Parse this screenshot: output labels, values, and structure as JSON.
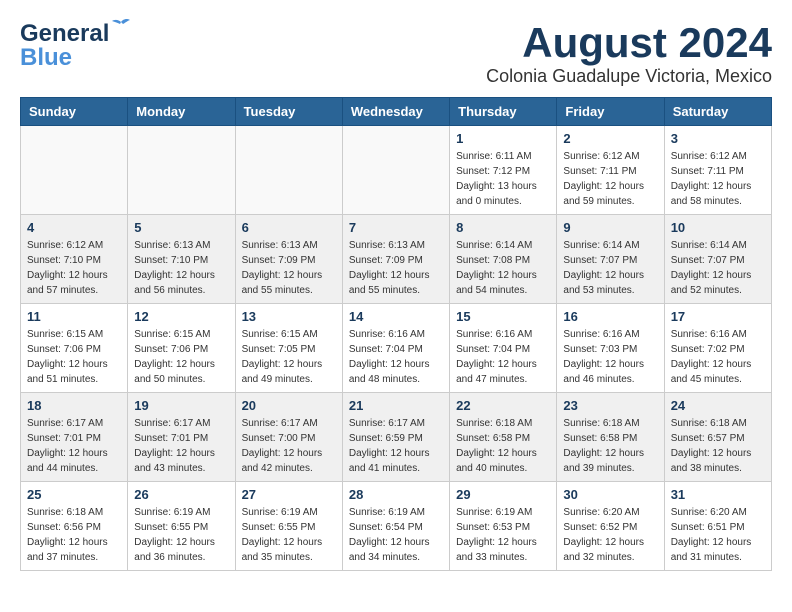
{
  "header": {
    "logo_line1": "General",
    "logo_line2": "Blue",
    "main_title": "August 2024",
    "subtitle": "Colonia Guadalupe Victoria, Mexico"
  },
  "days_of_week": [
    "Sunday",
    "Monday",
    "Tuesday",
    "Wednesday",
    "Thursday",
    "Friday",
    "Saturday"
  ],
  "weeks": [
    [
      {
        "day": "",
        "info": ""
      },
      {
        "day": "",
        "info": ""
      },
      {
        "day": "",
        "info": ""
      },
      {
        "day": "",
        "info": ""
      },
      {
        "day": "1",
        "info": "Sunrise: 6:11 AM\nSunset: 7:12 PM\nDaylight: 13 hours\nand 0 minutes."
      },
      {
        "day": "2",
        "info": "Sunrise: 6:12 AM\nSunset: 7:11 PM\nDaylight: 12 hours\nand 59 minutes."
      },
      {
        "day": "3",
        "info": "Sunrise: 6:12 AM\nSunset: 7:11 PM\nDaylight: 12 hours\nand 58 minutes."
      }
    ],
    [
      {
        "day": "4",
        "info": "Sunrise: 6:12 AM\nSunset: 7:10 PM\nDaylight: 12 hours\nand 57 minutes."
      },
      {
        "day": "5",
        "info": "Sunrise: 6:13 AM\nSunset: 7:10 PM\nDaylight: 12 hours\nand 56 minutes."
      },
      {
        "day": "6",
        "info": "Sunrise: 6:13 AM\nSunset: 7:09 PM\nDaylight: 12 hours\nand 55 minutes."
      },
      {
        "day": "7",
        "info": "Sunrise: 6:13 AM\nSunset: 7:09 PM\nDaylight: 12 hours\nand 55 minutes."
      },
      {
        "day": "8",
        "info": "Sunrise: 6:14 AM\nSunset: 7:08 PM\nDaylight: 12 hours\nand 54 minutes."
      },
      {
        "day": "9",
        "info": "Sunrise: 6:14 AM\nSunset: 7:07 PM\nDaylight: 12 hours\nand 53 minutes."
      },
      {
        "day": "10",
        "info": "Sunrise: 6:14 AM\nSunset: 7:07 PM\nDaylight: 12 hours\nand 52 minutes."
      }
    ],
    [
      {
        "day": "11",
        "info": "Sunrise: 6:15 AM\nSunset: 7:06 PM\nDaylight: 12 hours\nand 51 minutes."
      },
      {
        "day": "12",
        "info": "Sunrise: 6:15 AM\nSunset: 7:06 PM\nDaylight: 12 hours\nand 50 minutes."
      },
      {
        "day": "13",
        "info": "Sunrise: 6:15 AM\nSunset: 7:05 PM\nDaylight: 12 hours\nand 49 minutes."
      },
      {
        "day": "14",
        "info": "Sunrise: 6:16 AM\nSunset: 7:04 PM\nDaylight: 12 hours\nand 48 minutes."
      },
      {
        "day": "15",
        "info": "Sunrise: 6:16 AM\nSunset: 7:04 PM\nDaylight: 12 hours\nand 47 minutes."
      },
      {
        "day": "16",
        "info": "Sunrise: 6:16 AM\nSunset: 7:03 PM\nDaylight: 12 hours\nand 46 minutes."
      },
      {
        "day": "17",
        "info": "Sunrise: 6:16 AM\nSunset: 7:02 PM\nDaylight: 12 hours\nand 45 minutes."
      }
    ],
    [
      {
        "day": "18",
        "info": "Sunrise: 6:17 AM\nSunset: 7:01 PM\nDaylight: 12 hours\nand 44 minutes."
      },
      {
        "day": "19",
        "info": "Sunrise: 6:17 AM\nSunset: 7:01 PM\nDaylight: 12 hours\nand 43 minutes."
      },
      {
        "day": "20",
        "info": "Sunrise: 6:17 AM\nSunset: 7:00 PM\nDaylight: 12 hours\nand 42 minutes."
      },
      {
        "day": "21",
        "info": "Sunrise: 6:17 AM\nSunset: 6:59 PM\nDaylight: 12 hours\nand 41 minutes."
      },
      {
        "day": "22",
        "info": "Sunrise: 6:18 AM\nSunset: 6:58 PM\nDaylight: 12 hours\nand 40 minutes."
      },
      {
        "day": "23",
        "info": "Sunrise: 6:18 AM\nSunset: 6:58 PM\nDaylight: 12 hours\nand 39 minutes."
      },
      {
        "day": "24",
        "info": "Sunrise: 6:18 AM\nSunset: 6:57 PM\nDaylight: 12 hours\nand 38 minutes."
      }
    ],
    [
      {
        "day": "25",
        "info": "Sunrise: 6:18 AM\nSunset: 6:56 PM\nDaylight: 12 hours\nand 37 minutes."
      },
      {
        "day": "26",
        "info": "Sunrise: 6:19 AM\nSunset: 6:55 PM\nDaylight: 12 hours\nand 36 minutes."
      },
      {
        "day": "27",
        "info": "Sunrise: 6:19 AM\nSunset: 6:55 PM\nDaylight: 12 hours\nand 35 minutes."
      },
      {
        "day": "28",
        "info": "Sunrise: 6:19 AM\nSunset: 6:54 PM\nDaylight: 12 hours\nand 34 minutes."
      },
      {
        "day": "29",
        "info": "Sunrise: 6:19 AM\nSunset: 6:53 PM\nDaylight: 12 hours\nand 33 minutes."
      },
      {
        "day": "30",
        "info": "Sunrise: 6:20 AM\nSunset: 6:52 PM\nDaylight: 12 hours\nand 32 minutes."
      },
      {
        "day": "31",
        "info": "Sunrise: 6:20 AM\nSunset: 6:51 PM\nDaylight: 12 hours\nand 31 minutes."
      }
    ]
  ]
}
